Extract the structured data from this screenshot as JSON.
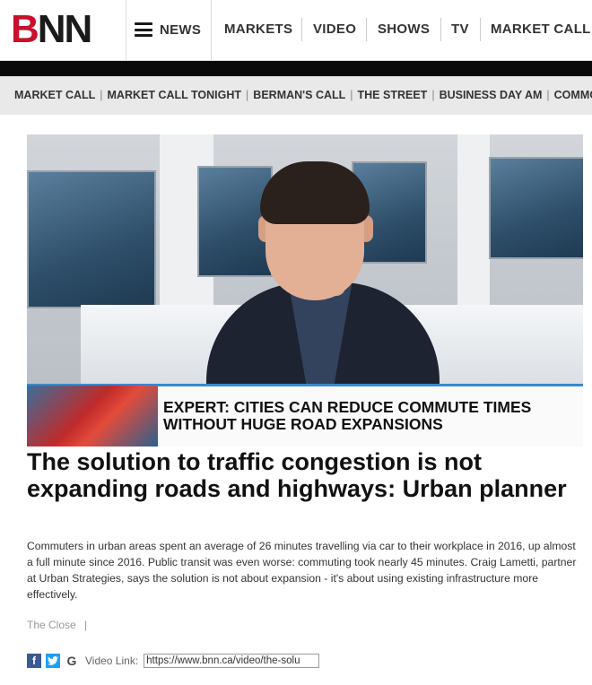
{
  "logo": {
    "text_b": "B",
    "text_nn": "NN"
  },
  "topnav": {
    "menu_label": "NEWS",
    "items": [
      "MARKETS",
      "VIDEO",
      "SHOWS",
      "TV",
      "MARKET CALL"
    ]
  },
  "subnav": {
    "items": [
      "MARKET CALL",
      "MARKET CALL TONIGHT",
      "BERMAN'S CALL",
      "THE STREET",
      "BUSINESS DAY AM",
      "COMMODITIES"
    ]
  },
  "video": {
    "lower_third": "EXPERT: CITIES CAN REDUCE COMMUTE TIMES WITHOUT HUGE ROAD EXPANSIONS"
  },
  "article": {
    "headline": "The solution to traffic congestion is not expanding roads and highways: Urban planner",
    "summary": "Commuters in urban areas spent an average of 26 minutes travelling via car to their workplace in 2016, up almost a full minute since 2016. Public transit was even worse: commuting took nearly 45 minutes. Craig Lametti, partner at Urban Strategies, says the solution is not about expansion - it's about using existing infrastructure more effectively.",
    "show": "The Close",
    "meta_sep": "|"
  },
  "share": {
    "facebook_glyph": "f",
    "twitter_glyph": "t",
    "google_glyph": "G",
    "video_link_label": "Video Link:",
    "video_link_value": "https://www.bnn.ca/video/the-solu"
  },
  "colors": {
    "brand_red": "#c8102e",
    "facebook": "#3b5998",
    "twitter": "#1da1f2"
  }
}
